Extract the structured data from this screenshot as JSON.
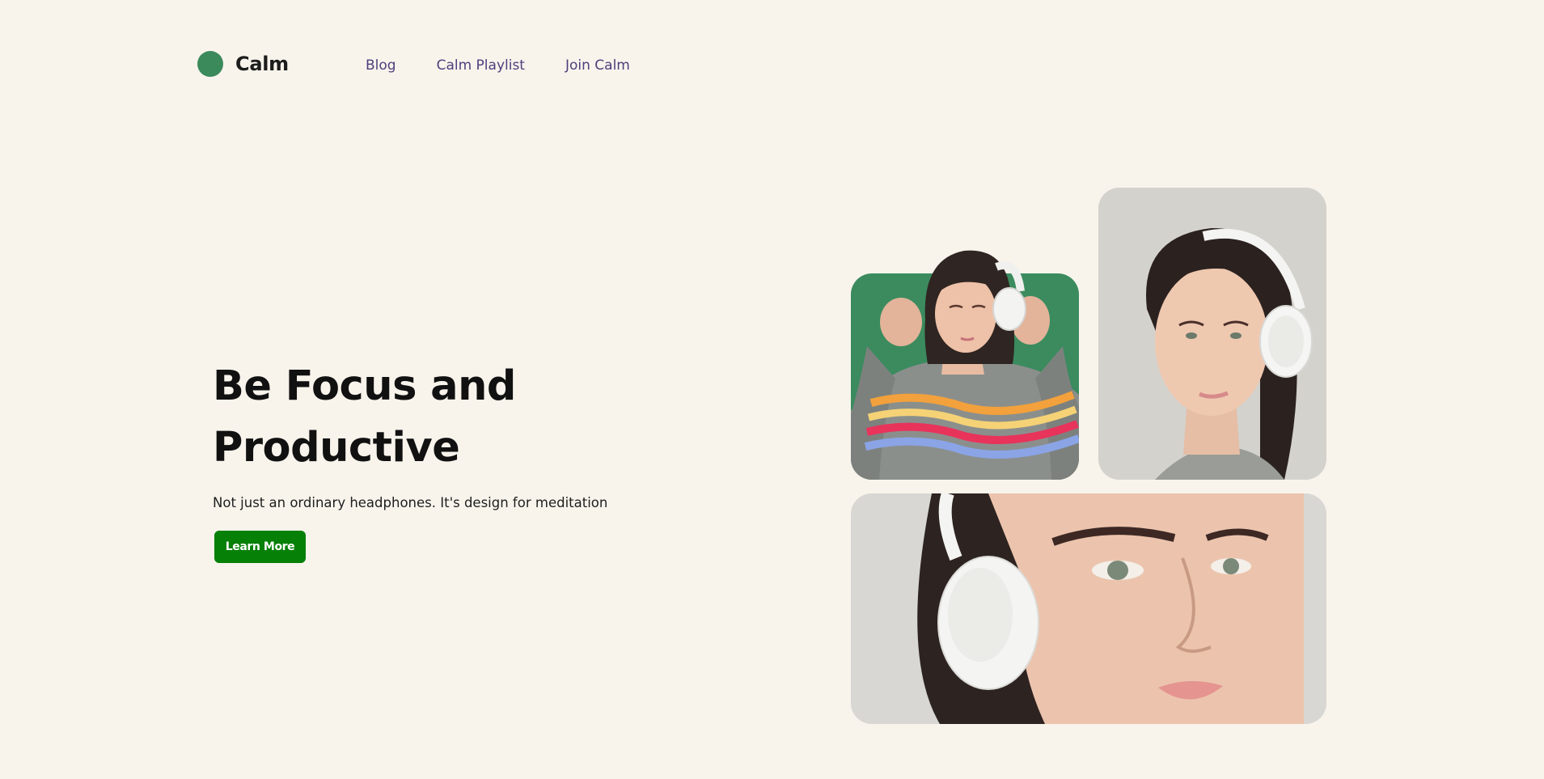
{
  "header": {
    "logo_text": "Calm",
    "nav": [
      {
        "label": "Blog"
      },
      {
        "label": "Calm Playlist"
      },
      {
        "label": "Join Calm"
      }
    ]
  },
  "hero": {
    "title_line1": "Be Focus and",
    "title_line2": "Productive",
    "subtitle": "Not just an ordinary headphones. It's design for meditation",
    "cta_label": "Learn More"
  },
  "gallery": {
    "images": [
      {
        "subject": "woman-in-striped-sweater-holding-headphones"
      },
      {
        "subject": "woman-wearing-white-headphones-portrait"
      },
      {
        "subject": "woman-with-white-headphones-closeup"
      }
    ]
  },
  "colors": {
    "background": "#f8f4ec",
    "brand_green": "#3b8a5c",
    "nav_text": "#4e3f7c",
    "button": "#078007"
  }
}
